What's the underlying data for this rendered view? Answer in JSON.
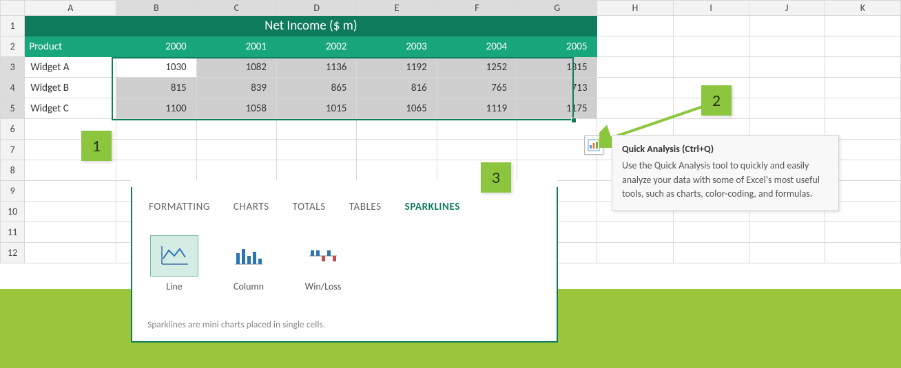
{
  "columns": [
    "A",
    "B",
    "C",
    "D",
    "E",
    "F",
    "G",
    "H",
    "I",
    "J",
    "K"
  ],
  "rows": [
    1,
    2,
    3,
    4,
    5,
    6,
    7,
    8,
    9,
    10,
    11,
    12
  ],
  "title": "Net Income ($ m)",
  "header_first": "Product",
  "years": [
    "2000",
    "2001",
    "2002",
    "2003",
    "2004",
    "2005"
  ],
  "products": [
    {
      "name": "Widget A",
      "vals": [
        "1030",
        "1082",
        "1136",
        "1192",
        "1252",
        "1315"
      ]
    },
    {
      "name": "Widget B",
      "vals": [
        "815",
        "839",
        "865",
        "816",
        "765",
        "713"
      ]
    },
    {
      "name": "Widget C",
      "vals": [
        "1100",
        "1058",
        "1015",
        "1065",
        "1119",
        "1175"
      ]
    }
  ],
  "callouts": {
    "c1": "1",
    "c2": "2",
    "c3": "3"
  },
  "tooltip": {
    "title": "Quick Analysis (Ctrl+Q)",
    "body": "Use the Quick Analysis tool to quickly and easily analyze your data with some of Excel's most useful tools, such as charts, color-coding, and formulas."
  },
  "qa": {
    "tabs": [
      "FORMATTING",
      "CHARTS",
      "TOTALS",
      "TABLES",
      "SPARKLINES"
    ],
    "active_tab": 4,
    "options": [
      {
        "label": "Line",
        "icon": "line-sparkline-icon"
      },
      {
        "label": "Column",
        "icon": "column-sparkline-icon"
      },
      {
        "label": "Win/Loss",
        "icon": "winloss-sparkline-icon"
      }
    ],
    "active_option": 0,
    "hint": "Sparklines are mini charts placed in single cells."
  },
  "chart_data": {
    "type": "table",
    "title": "Net Income ($ m)",
    "categories": [
      "2000",
      "2001",
      "2002",
      "2003",
      "2004",
      "2005"
    ],
    "series": [
      {
        "name": "Widget A",
        "values": [
          1030,
          1082,
          1136,
          1192,
          1252,
          1315
        ]
      },
      {
        "name": "Widget B",
        "values": [
          815,
          839,
          865,
          816,
          765,
          713
        ]
      },
      {
        "name": "Widget C",
        "values": [
          1100,
          1058,
          1015,
          1065,
          1119,
          1175
        ]
      }
    ]
  }
}
